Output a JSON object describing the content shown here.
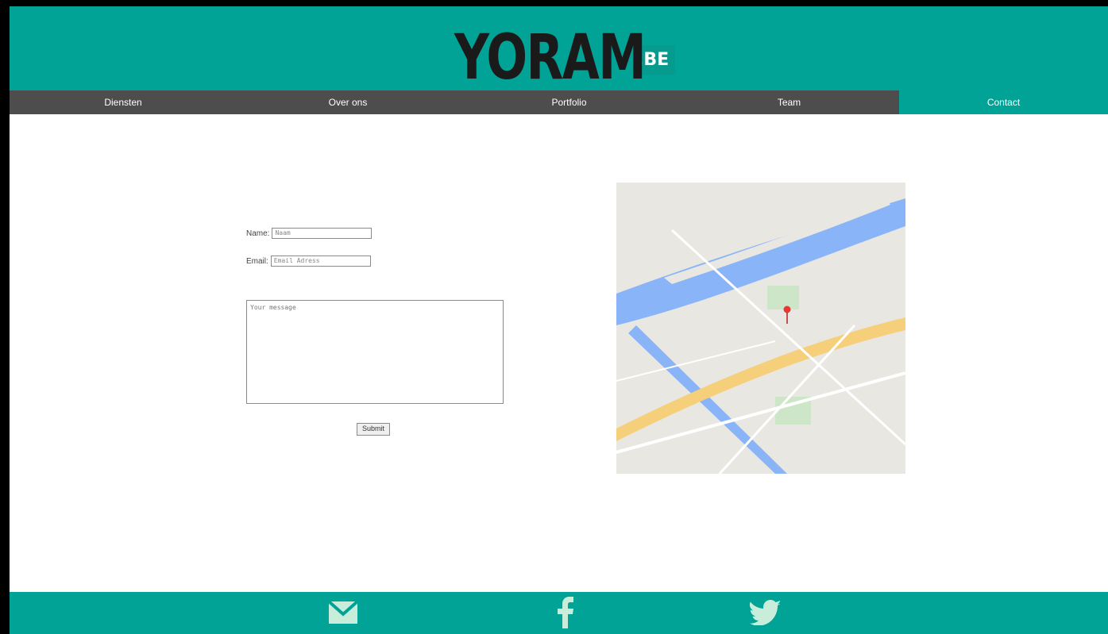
{
  "brand": {
    "logo_main": "YORAM",
    "logo_tld": ".BE"
  },
  "nav": {
    "items": [
      {
        "label": "Diensten",
        "active": false
      },
      {
        "label": "Over ons",
        "active": false
      },
      {
        "label": "Portfolio",
        "active": false
      },
      {
        "label": "Team",
        "active": false
      },
      {
        "label": "Contact",
        "active": true
      }
    ]
  },
  "form": {
    "name_label": "Name:",
    "name_placeholder": "Naam",
    "email_label": "Email:",
    "email_placeholder": "Email Adress",
    "message_placeholder": "Your message",
    "submit_label": "Submit"
  },
  "map": {
    "icon": "location-pin-icon"
  },
  "footer": {
    "icons": [
      "mail-icon",
      "facebook-icon",
      "twitter-icon"
    ]
  },
  "colors": {
    "teal": "#00a396",
    "nav_bg": "#4d4d4d",
    "icon": "#c8eedb"
  }
}
